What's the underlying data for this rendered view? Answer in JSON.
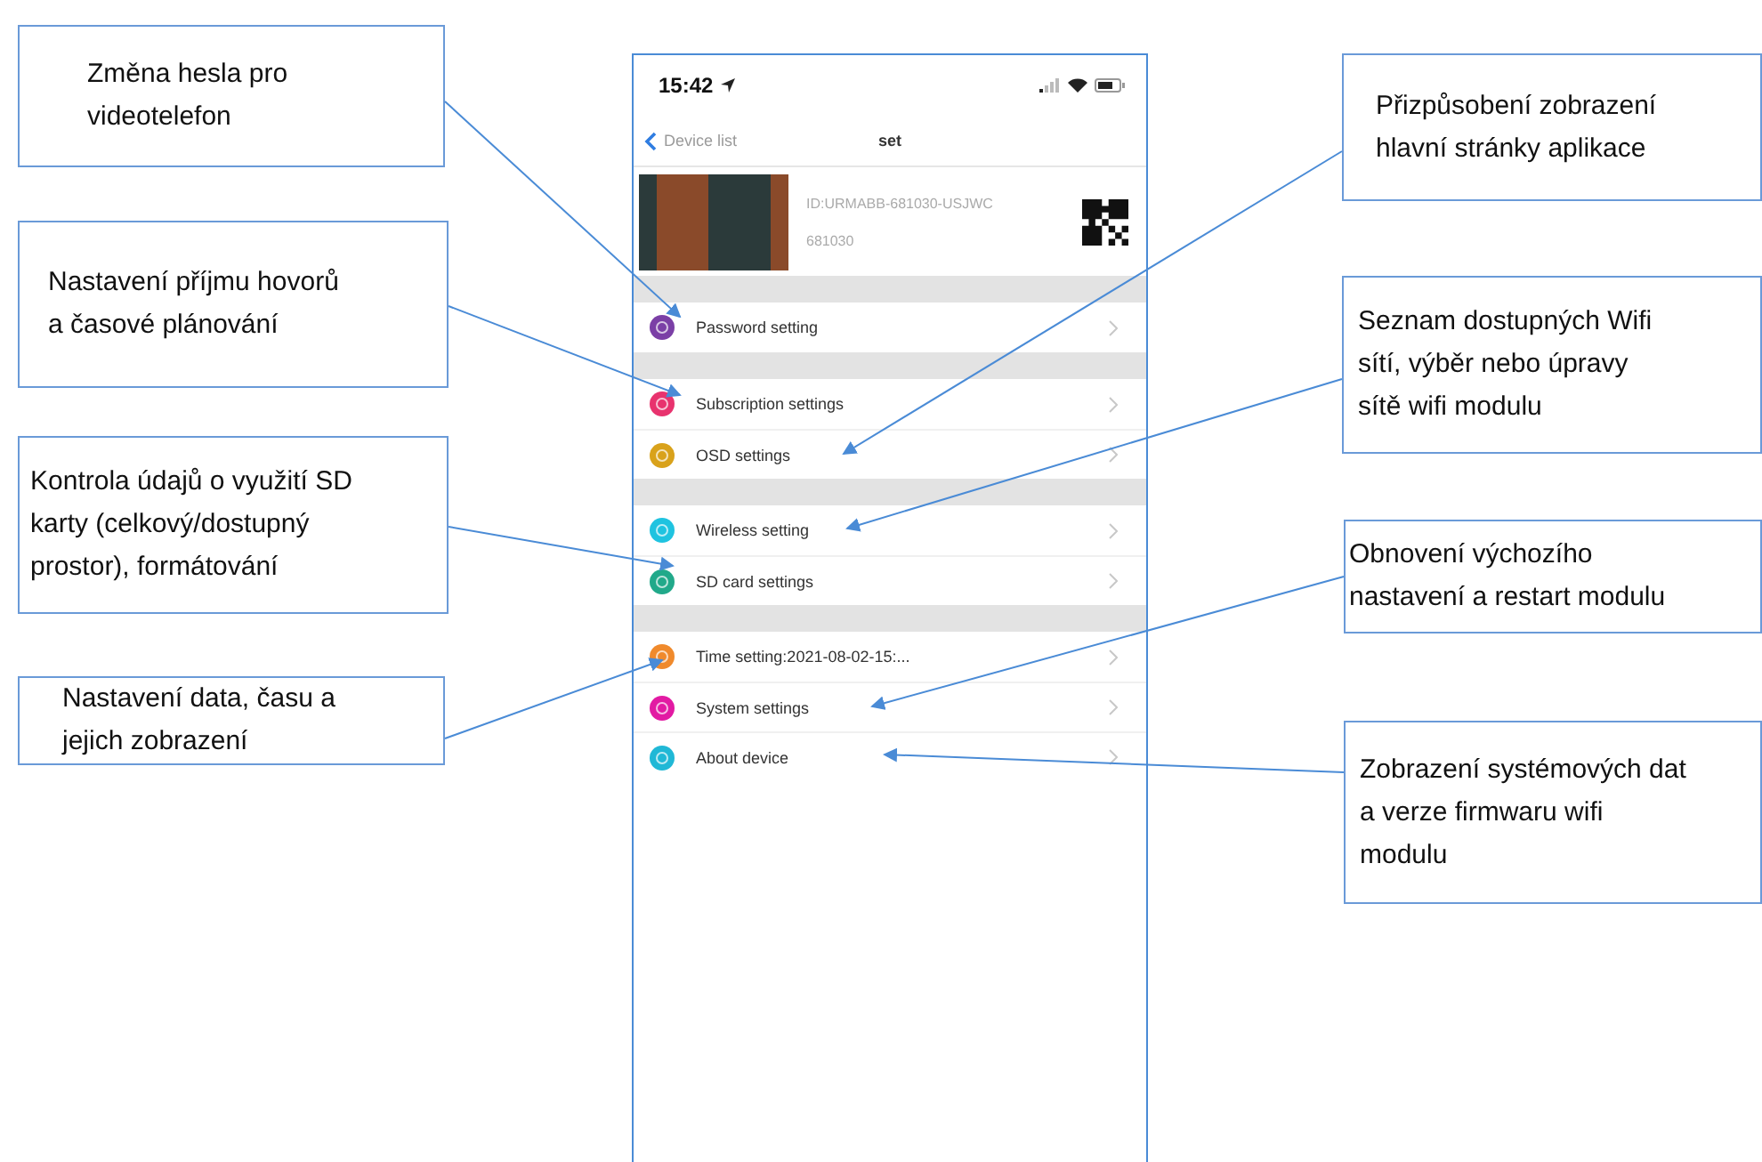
{
  "phone": {
    "status_bar": {
      "time": "15:42"
    },
    "nav": {
      "back": "Device list",
      "title": "set"
    },
    "device": {
      "id": "ID:URMABB-681030-USJWC",
      "name": "681030"
    },
    "sections": [
      {
        "items": [
          {
            "label": "Password setting",
            "color": "#7b3fa6"
          }
        ]
      },
      {
        "items": [
          {
            "label": "Subscription settings",
            "color": "#e8336e"
          },
          {
            "label": "OSD settings",
            "color": "#d9a21b"
          }
        ]
      },
      {
        "items": [
          {
            "label": "Wireless setting",
            "color": "#1fc3e0"
          },
          {
            "label": "SD card settings",
            "color": "#21a98a"
          }
        ]
      },
      {
        "items": [
          {
            "label": "Time setting:2021-08-02-15:...",
            "color": "#f08a2c"
          },
          {
            "label": "System settings",
            "color": "#e21aa3"
          },
          {
            "label": "About device",
            "color": "#20b8d6"
          }
        ]
      }
    ]
  },
  "callouts": [
    {
      "text": "Změna hesla pro videotelefon"
    },
    {
      "text": "Nastavení příjmu hovorů a časové plánování"
    },
    {
      "text": "Kontrola údajů o využití SD karty (celkový/dostupný prostor), formátování"
    },
    {
      "text": "Nastavení data, času a jejich zobrazení"
    },
    {
      "text": "Přizpůsobení zobrazení hlavní stránky aplikace"
    },
    {
      "text": "Seznam dostupných Wifi sítí, výběr nebo úpravy sítě wifi modulu"
    },
    {
      "text": "Obnovení výchozího nastavení a restart modulu"
    },
    {
      "text": "Zobrazení systémových dat a verze firmwaru wifi modulu"
    }
  ]
}
